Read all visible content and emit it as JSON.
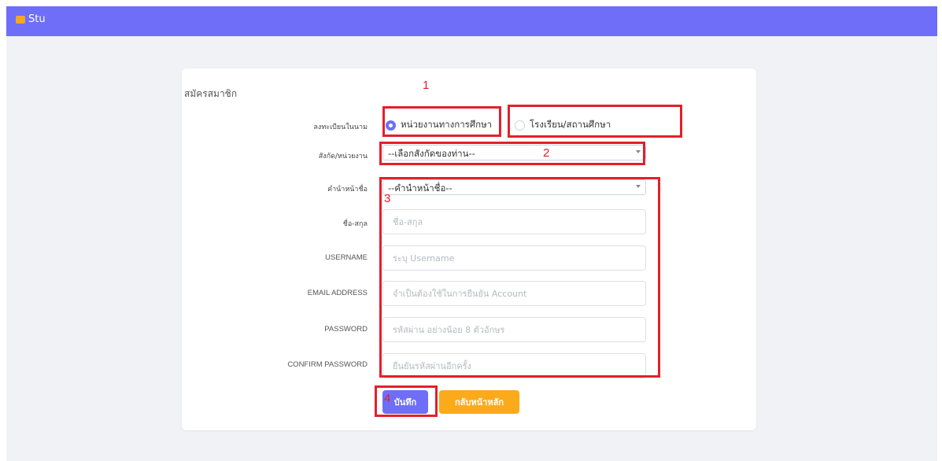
{
  "navbar": {
    "brand": "Stu"
  },
  "card": {
    "title": "สมัครสมาชิก"
  },
  "form": {
    "register_as_label": "ลงทะเบียนในนาม",
    "register_options": [
      "หน่วยงานทางการศึกษา",
      "โรงเรียน/สถานศึกษา"
    ],
    "register_selected": "หน่วยงานทางการศึกษา",
    "affiliation_label": "สังกัด/หน่วยงาน",
    "affiliation_value": "--เลือกสังกัดของท่าน--",
    "prefix_label": "คำนำหน้าชื่อ",
    "prefix_value": "--คำนำหน้าชื่อ--",
    "fullname_label": "ชื่อ-สกุล",
    "fullname_placeholder": "ชื่อ-สกุล",
    "username_label": "USERNAME",
    "username_placeholder": "ระบุ Username",
    "email_label": "EMAIL ADDRESS",
    "email_placeholder": "จำเป็นต้องใช้ในการยืนยัน Account",
    "password_label": "PASSWORD",
    "password_placeholder": "รหัสผ่าน อย่างน้อย 8 ตัวอักษร",
    "confirm_label": "CONFIRM PASSWORD",
    "confirm_placeholder": "ยืนยันรหัสผ่านอีกครั้ง",
    "save_button": "บันทึก",
    "back_button": "กลับหน้าหลัก"
  },
  "annotations": [
    "1",
    "2",
    "3",
    "4"
  ],
  "colors": {
    "primary": "#6e6ef9",
    "warning": "#fbaa1b",
    "annotation": "#e3202a"
  }
}
